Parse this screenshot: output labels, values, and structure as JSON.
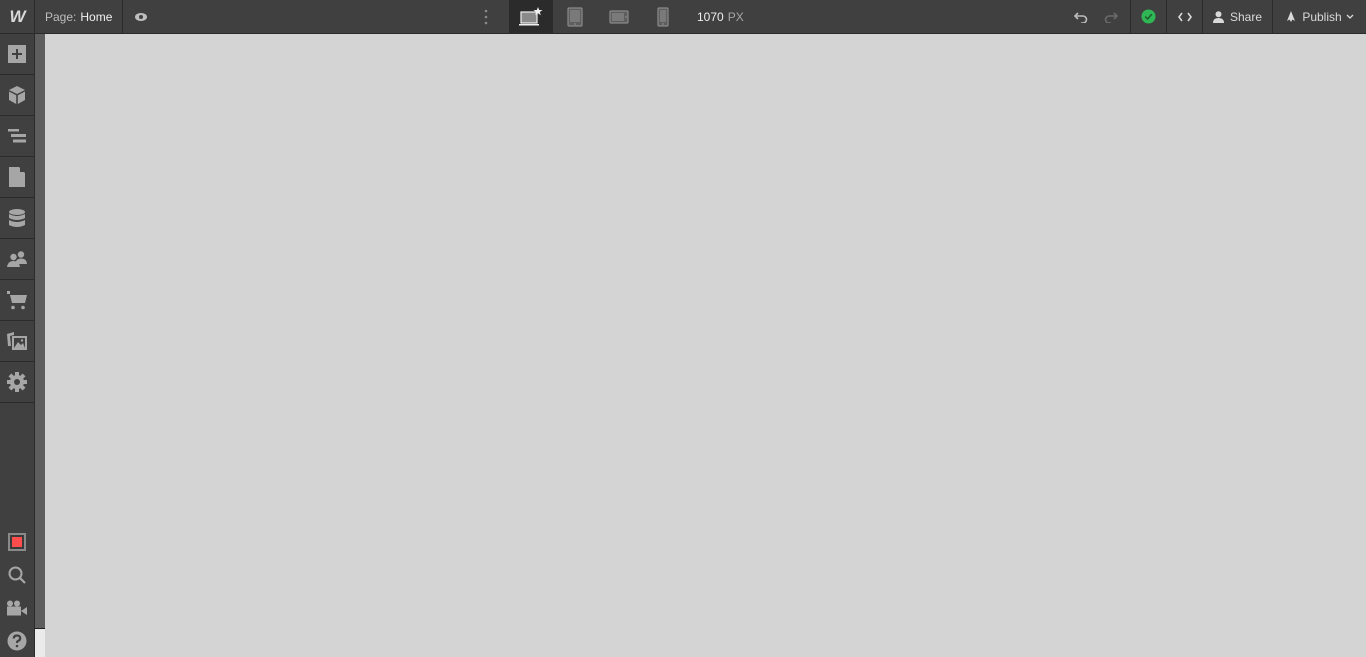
{
  "topbar": {
    "logo": "W",
    "page_prefix": "Page:",
    "page_name": "Home",
    "breakpoints": [
      {
        "name": "desktop",
        "active": true
      },
      {
        "name": "tablet",
        "active": false
      },
      {
        "name": "mobile-landscape",
        "active": false
      },
      {
        "name": "mobile-portrait",
        "active": false
      }
    ],
    "width_value": "1070",
    "width_unit": "PX",
    "status_color": "#2fb755",
    "share_label": "Share",
    "publish_label": "Publish"
  },
  "sidebar": {
    "items": [
      {
        "icon": "add-panel-icon",
        "label": "Add"
      },
      {
        "icon": "symbols-icon",
        "label": "Symbols"
      },
      {
        "icon": "navigator-icon",
        "label": "Navigator"
      },
      {
        "icon": "pages-icon",
        "label": "Pages"
      },
      {
        "icon": "cms-icon",
        "label": "CMS"
      },
      {
        "icon": "users-icon",
        "label": "Users"
      },
      {
        "icon": "ecommerce-icon",
        "label": "Ecommerce"
      },
      {
        "icon": "assets-icon",
        "label": "Assets"
      },
      {
        "icon": "settings-icon",
        "label": "Settings"
      }
    ],
    "bottom_items": [
      {
        "icon": "audit-icon",
        "accent": "#ff4d4d"
      },
      {
        "icon": "search-icon"
      },
      {
        "icon": "video-tutorials-icon"
      },
      {
        "icon": "help-icon"
      }
    ]
  }
}
